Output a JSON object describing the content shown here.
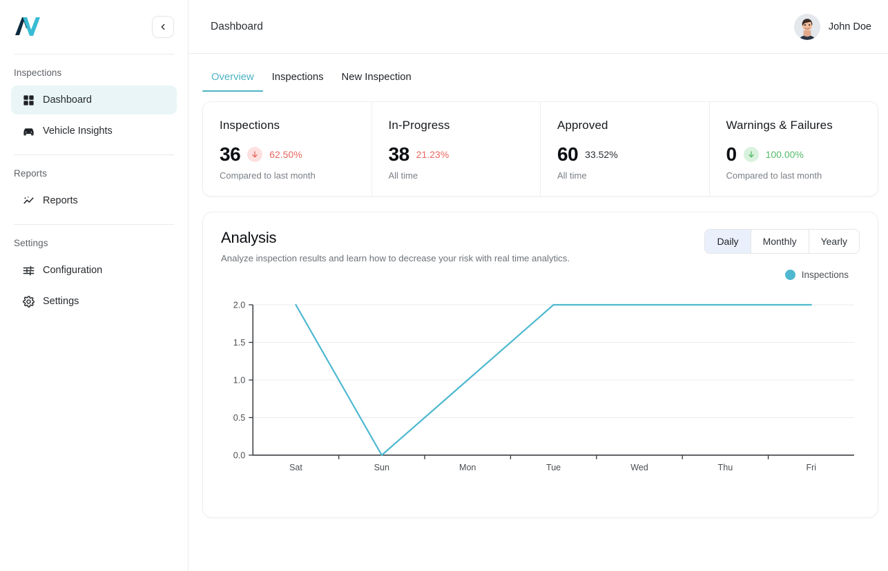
{
  "sidebar": {
    "logo_alt": "vehicle-inspection-logo",
    "collapse_label": "‹",
    "sections": [
      {
        "label": "Inspections",
        "items": [
          {
            "label": "Dashboard",
            "icon": "grid-icon",
            "active": true
          },
          {
            "label": "Vehicle Insights",
            "icon": "car-icon",
            "active": false
          }
        ]
      },
      {
        "label": "Reports",
        "items": [
          {
            "label": "Reports",
            "icon": "insights-icon",
            "active": false
          }
        ]
      },
      {
        "label": "Settings",
        "items": [
          {
            "label": "Configuration",
            "icon": "tune-icon",
            "active": false
          },
          {
            "label": "Settings",
            "icon": "gear-icon",
            "active": false
          }
        ]
      }
    ]
  },
  "header": {
    "title": "Dashboard",
    "user_name": "John Doe",
    "avatar_alt": "user-avatar"
  },
  "tabs": [
    {
      "label": "Overview",
      "active": true
    },
    {
      "label": "Inspections",
      "active": false
    },
    {
      "label": "New Inspection",
      "active": false
    }
  ],
  "stats": [
    {
      "title": "Inspections",
      "value": "36",
      "pct": "62.50%",
      "pct_color": "red",
      "badge": "down-red",
      "has_badge": true,
      "note": "Compared to last month"
    },
    {
      "title": "In-Progress",
      "value": "38",
      "pct": "21.23%",
      "pct_color": "red",
      "badge": "",
      "has_badge": false,
      "note": "All time"
    },
    {
      "title": "Approved",
      "value": "60",
      "pct": "33.52%",
      "pct_color": "grey",
      "badge": "",
      "has_badge": false,
      "note": "All time"
    },
    {
      "title": "Warnings & Failures",
      "value": "0",
      "pct": "100.00%",
      "pct_color": "green",
      "badge": "down-green",
      "has_badge": true,
      "note": "Compared to last month"
    }
  ],
  "analysis": {
    "title": "Analysis",
    "subtitle": "Analyze inspection results and learn how to decrease your risk with real time analytics.",
    "range_options": [
      {
        "label": "Daily",
        "active": true
      },
      {
        "label": "Monthly",
        "active": false
      },
      {
        "label": "Yearly",
        "active": false
      }
    ],
    "legend": [
      {
        "label": "Inspections",
        "color": "#4db8cf"
      }
    ]
  },
  "colors": {
    "accent_teal": "#4db3c4",
    "line_teal": "#4db8cf",
    "active_nav_bg": "#e9f5f7",
    "positive_green": "#54b969",
    "negative_red": "#e8675f",
    "segment_active_bg": "#eaf0fb"
  },
  "chart_data": {
    "type": "line",
    "title": "Analysis",
    "categories": [
      "Sat",
      "Sun",
      "Mon",
      "Tue",
      "Wed",
      "Thu",
      "Fri"
    ],
    "series": [
      {
        "name": "Inspections",
        "values": [
          2,
          0,
          1,
          2,
          2,
          2,
          2
        ],
        "color": "#4db8cf"
      }
    ],
    "yticks": [
      "0.0",
      "0.5",
      "1.0",
      "1.5",
      "2.0"
    ],
    "ylim": [
      0,
      2
    ],
    "xlabel": "",
    "ylabel": "",
    "grid": true,
    "legend_position": "top-right"
  }
}
